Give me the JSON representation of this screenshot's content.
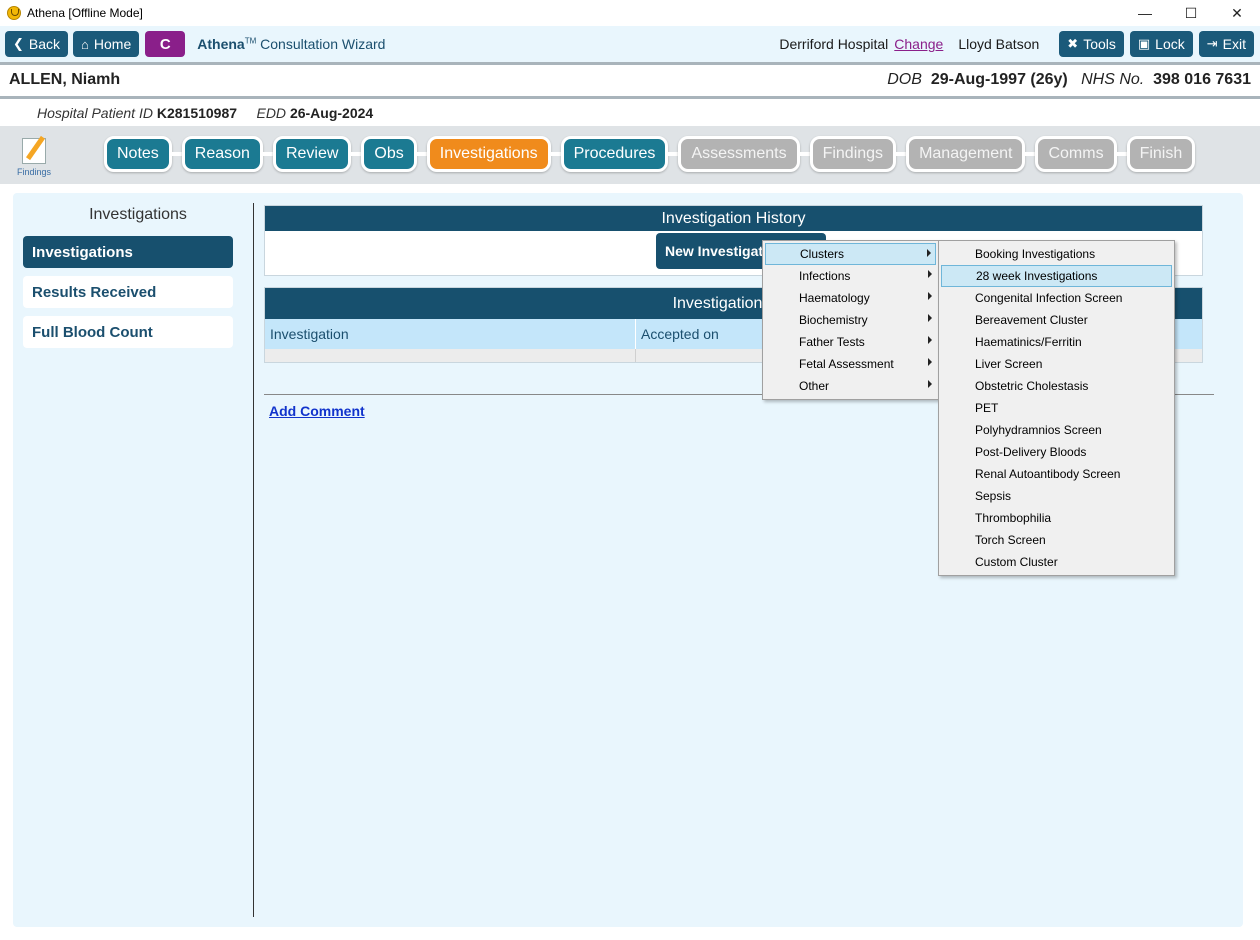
{
  "window": {
    "title": "Athena [Offline Mode]",
    "minimize": "—",
    "maximize": "☐",
    "close": "✕"
  },
  "toolbar": {
    "back_label": "Back",
    "home_label": "Home",
    "c_label": "C",
    "app_name": "Athena",
    "tm": "TM",
    "wizard_label": "Consultation Wizard",
    "hospital": "Derriford Hospital",
    "change_label": "Change",
    "user": "Lloyd Batson",
    "tools_label": "Tools",
    "lock_label": "Lock",
    "exit_label": "Exit"
  },
  "patient": {
    "name": "ALLEN, Niamh",
    "dob_label": "DOB",
    "dob_value": "29-Aug-1997 (26y)",
    "nhs_label": "NHS No.",
    "nhs_value": "398 016 7631",
    "hpid_label": "Hospital Patient ID",
    "hpid_value": "K281510987",
    "edd_label": "EDD",
    "edd_value": "26-Aug-2024"
  },
  "stepbar": {
    "findings_icon_label": "Findings",
    "steps": [
      {
        "label": "Notes",
        "state": "done"
      },
      {
        "label": "Reason",
        "state": "done"
      },
      {
        "label": "Review",
        "state": "done"
      },
      {
        "label": "Obs",
        "state": "done"
      },
      {
        "label": "Investigations",
        "state": "active"
      },
      {
        "label": "Procedures",
        "state": "done"
      },
      {
        "label": "Assessments",
        "state": "todo"
      },
      {
        "label": "Findings",
        "state": "todo"
      },
      {
        "label": "Management",
        "state": "todo"
      },
      {
        "label": "Comms",
        "state": "todo"
      },
      {
        "label": "Finish",
        "state": "todo"
      }
    ]
  },
  "sidebar": {
    "title": "Investigations",
    "items": [
      {
        "label": "Investigations",
        "selected": true
      },
      {
        "label": "Results Received",
        "selected": false
      },
      {
        "label": "Full Blood Count",
        "selected": false
      }
    ]
  },
  "main": {
    "history_title": "Investigation History",
    "new_button_label": "New Investigation",
    "list_title": "Investigations - A",
    "columns": [
      "Investigation",
      "Accepted on"
    ],
    "add_comment": "Add Comment"
  },
  "menu": {
    "categories": [
      {
        "label": "Clusters",
        "highlighted": true
      },
      {
        "label": "Infections",
        "highlighted": false
      },
      {
        "label": "Haematology",
        "highlighted": false
      },
      {
        "label": "Biochemistry",
        "highlighted": false
      },
      {
        "label": "Father Tests",
        "highlighted": false
      },
      {
        "label": "Fetal Assessment",
        "highlighted": false
      },
      {
        "label": "Other",
        "highlighted": false
      }
    ],
    "clusters": [
      {
        "label": "Booking Investigations",
        "highlighted": false
      },
      {
        "label": "28 week Investigations",
        "highlighted": true
      },
      {
        "label": "Congenital Infection Screen",
        "highlighted": false
      },
      {
        "label": "Bereavement Cluster",
        "highlighted": false
      },
      {
        "label": "Haematinics/Ferritin",
        "highlighted": false
      },
      {
        "label": "Liver Screen",
        "highlighted": false
      },
      {
        "label": "Obstetric Cholestasis",
        "highlighted": false
      },
      {
        "label": "PET",
        "highlighted": false
      },
      {
        "label": "Polyhydramnios Screen",
        "highlighted": false
      },
      {
        "label": "Post-Delivery Bloods",
        "highlighted": false
      },
      {
        "label": "Renal Autoantibody Screen",
        "highlighted": false
      },
      {
        "label": "Sepsis",
        "highlighted": false
      },
      {
        "label": "Thrombophilia",
        "highlighted": false
      },
      {
        "label": "Torch Screen",
        "highlighted": false
      },
      {
        "label": "Custom Cluster",
        "highlighted": false
      }
    ]
  }
}
